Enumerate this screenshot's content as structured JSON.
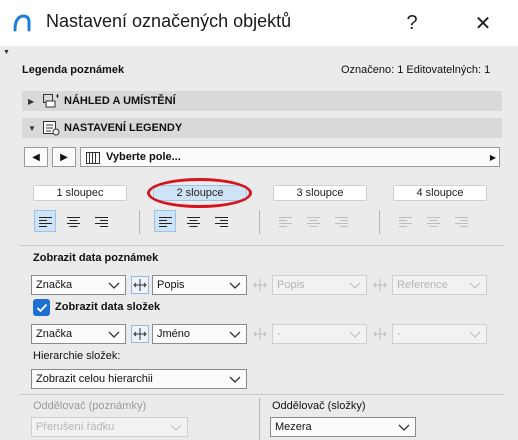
{
  "window": {
    "title": "Nastavení označených objektů",
    "help_label": "?",
    "close_label": "✕"
  },
  "header": {
    "section_title": "Legenda poznámek",
    "selection_info": "Označeno: 1 Editovatelných: 1"
  },
  "sections": [
    {
      "label": "NÁHLED A UMÍSTĚNÍ",
      "expanded": false
    },
    {
      "label": "NASTAVENÍ LEGENDY",
      "expanded": true
    }
  ],
  "field_selector": {
    "prev_label": "◀",
    "next_label": "▶",
    "value": "Vyberte pole..."
  },
  "columns": {
    "items": [
      "1 sloupec",
      "2 sloupce",
      "3 sloupce",
      "4 sloupce"
    ],
    "selected_index": 1
  },
  "note_data": {
    "heading": "Zobrazit data poznámek",
    "col1": "Značka",
    "col2": "Popis",
    "col3": "Popis",
    "col4": "Reference"
  },
  "component_data": {
    "checkbox_label": "Zobrazit data složek",
    "checked": true,
    "col1": "Značka",
    "col2": "Jméno",
    "col3": "-",
    "col4": "-"
  },
  "hierarchy": {
    "label": "Hierarchie složek:",
    "value": "Zobrazit celou hierarchii"
  },
  "separators": {
    "notes_label": "Oddělovač (poznámky)",
    "notes_value": "Přerušení řádku",
    "components_label": "Oddělovač (složky)",
    "components_value": "Mezera"
  },
  "colors": {
    "accent": "#1f6fd1",
    "selected_bg": "#cfe3f7",
    "annotation_red": "#d6141b"
  }
}
